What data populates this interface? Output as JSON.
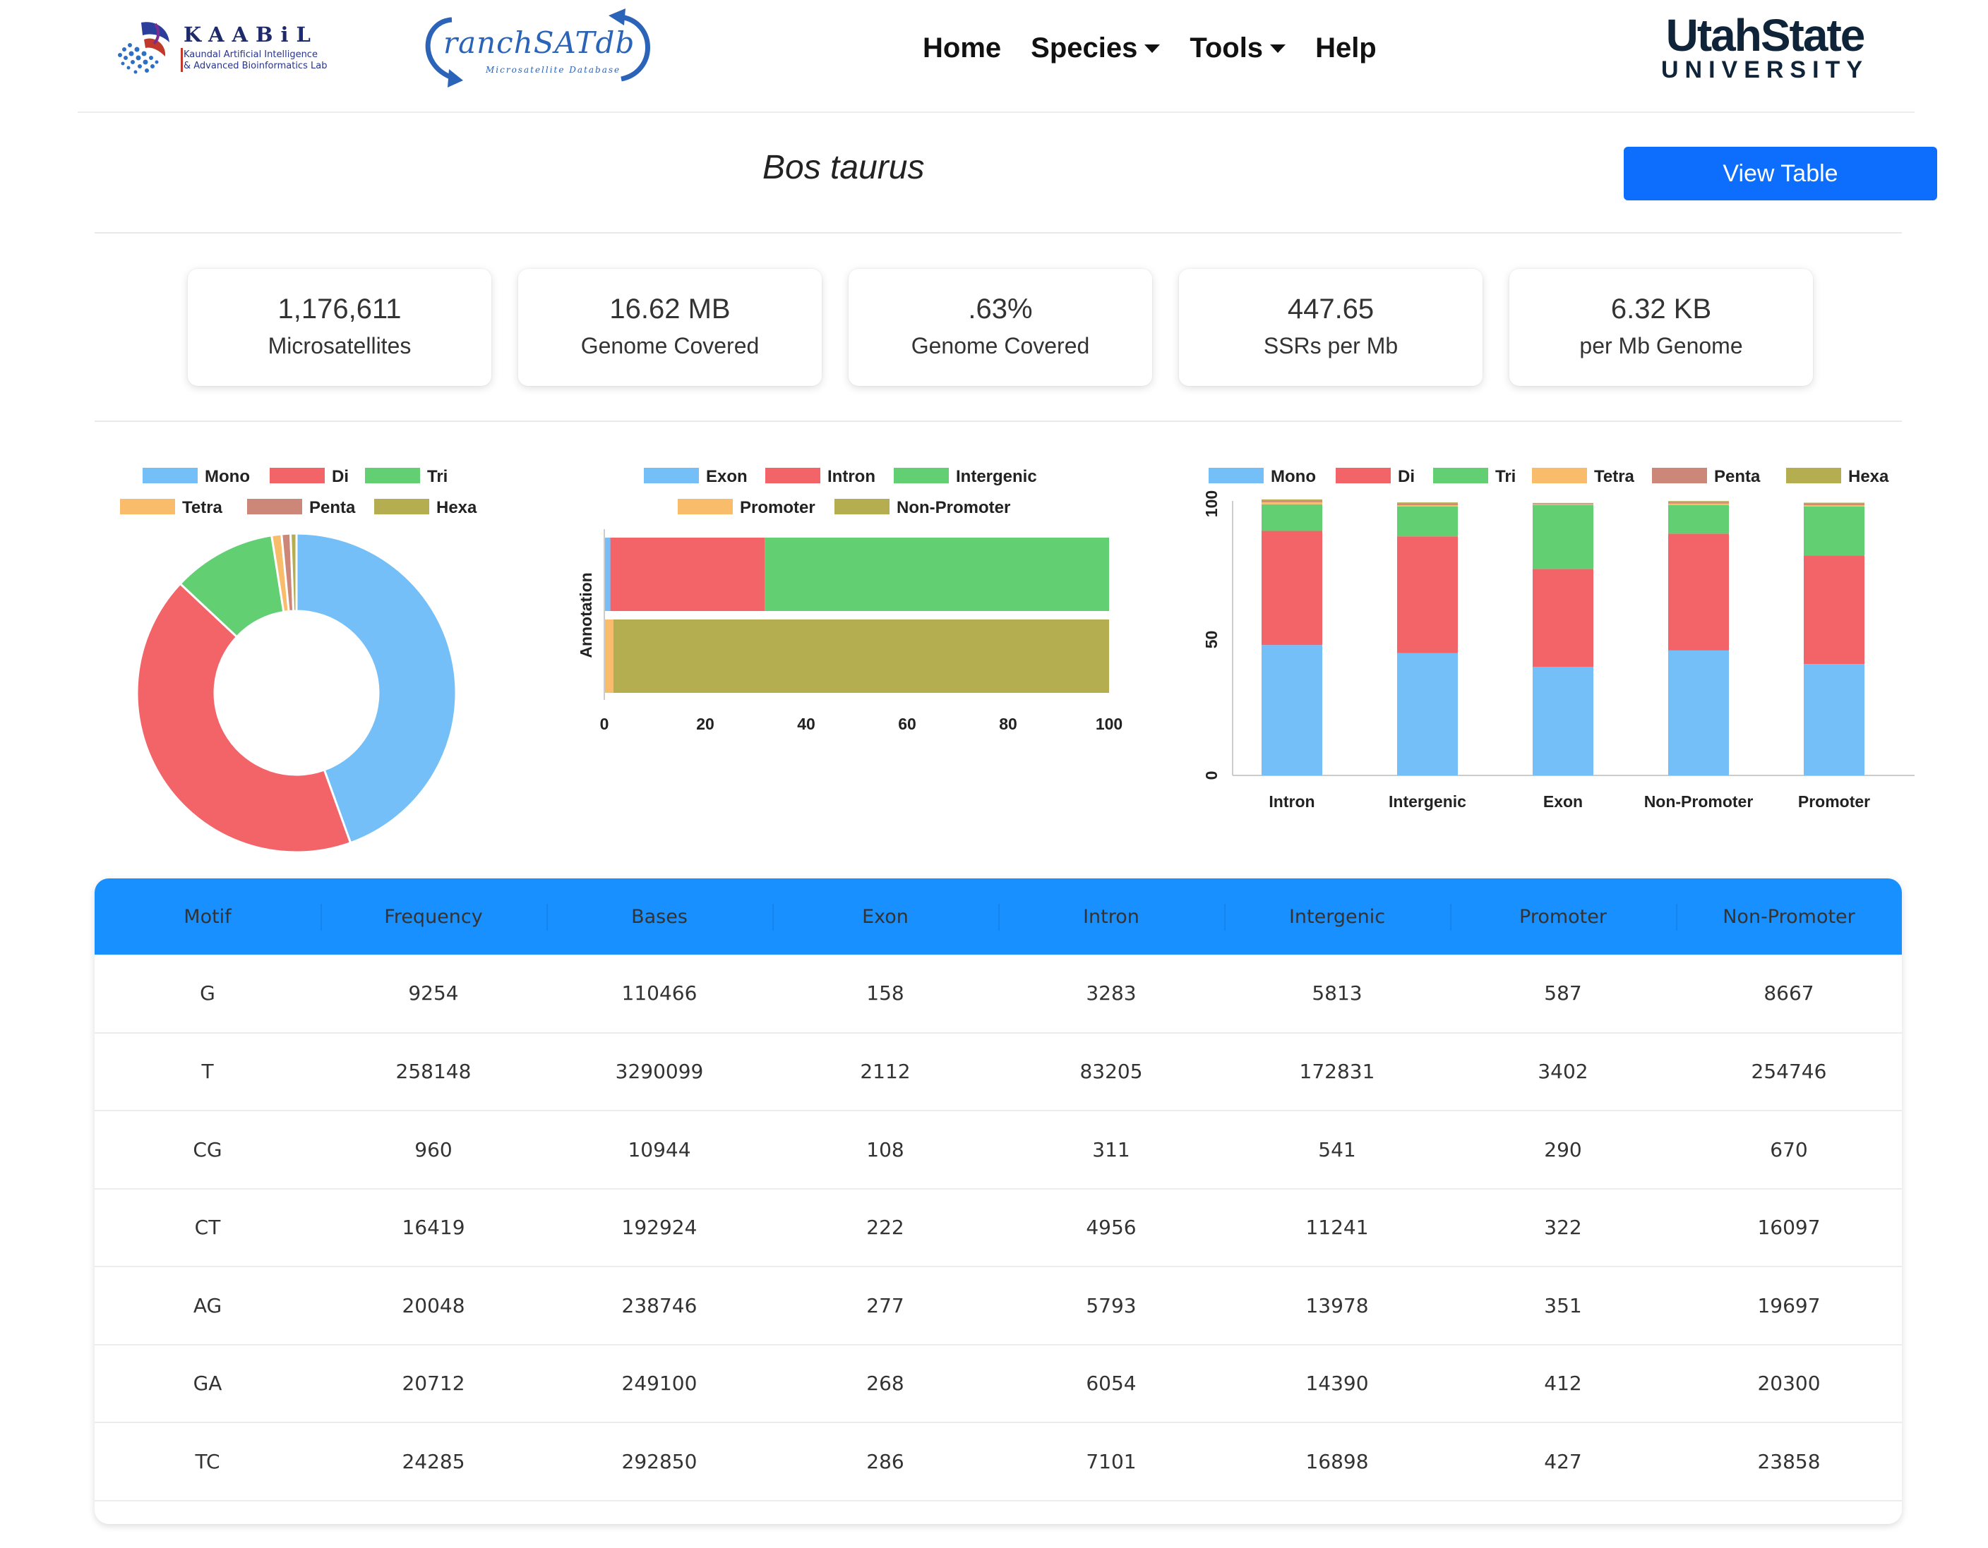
{
  "navbar": {
    "kaabil_logo": {
      "title": "KAABiL",
      "line1": "Kaundal Artificial Intelligence",
      "line2": "& Advanced Bioinformatics Lab"
    },
    "ranch_logo": {
      "title": "ranchSATdb",
      "subtitle": "Microsatellite Database"
    },
    "links": [
      {
        "label": "Home"
      },
      {
        "label": "Species"
      },
      {
        "label": "Tools"
      },
      {
        "label": "Help"
      }
    ],
    "usu_logo": {
      "line1": "UtahState",
      "line2": "UNIVERSITY"
    }
  },
  "header": {
    "species": "Bos taurus",
    "view_table_label": "View Table"
  },
  "stats": [
    {
      "value": "1,176,611",
      "label": "Microsatellites"
    },
    {
      "value": "16.62 MB",
      "label": "Genome Covered"
    },
    {
      "value": ".63%",
      "label": "Genome Covered"
    },
    {
      "value": "447.65",
      "label": "SSRs per Mb"
    },
    {
      "value": "6.32 KB",
      "label": "per Mb Genome"
    }
  ],
  "colors": {
    "mono": "#74bff8",
    "di": "#f26468",
    "tri": "#63cf73",
    "tetra": "#f9bc6b",
    "penta": "#cd8778",
    "hexa": "#b4ae50",
    "exon": "#74bff8",
    "intron": "#f26468",
    "intergenic": "#63cf73",
    "promoter": "#f9bc6b",
    "non_promoter": "#b4ae50",
    "accent": "#0d6efd",
    "table_header": "#1890ff"
  },
  "chart_data": [
    {
      "type": "pie",
      "donut": true,
      "legend": [
        "Mono",
        "Di",
        "Tri",
        "Tetra",
        "Penta",
        "Hexa"
      ],
      "values": [
        44.5,
        42.5,
        10.5,
        1.0,
        0.9,
        0.6
      ],
      "legend_position": "top"
    },
    {
      "type": "bar",
      "orientation": "horizontal",
      "stacked": true,
      "ylabel": "Annotation",
      "legend": [
        "Exon",
        "Intron",
        "Intergenic",
        "Promoter",
        "Non-Promoter"
      ],
      "xlim": [
        0,
        100
      ],
      "x_ticks": [
        "0",
        "20",
        "40",
        "60",
        "80",
        "100"
      ],
      "bars": [
        {
          "segments": [
            {
              "name": "Exon",
              "value": 1.2
            },
            {
              "name": "Intron",
              "value": 30.6
            },
            {
              "name": "Intergenic",
              "value": 68.2
            }
          ]
        },
        {
          "segments": [
            {
              "name": "Promoter",
              "value": 1.8
            },
            {
              "name": "Non-Promoter",
              "value": 98.2
            }
          ]
        }
      ]
    },
    {
      "type": "bar",
      "stacked": true,
      "categories": [
        "Intron",
        "Intergenic",
        "Exon",
        "Non-Promoter",
        "Promoter"
      ],
      "ylim": [
        0,
        100
      ],
      "y_ticks": [
        "0",
        "50",
        "100"
      ],
      "series": [
        {
          "name": "Mono",
          "values": [
            48,
            45,
            40,
            46,
            41
          ]
        },
        {
          "name": "Di",
          "values": [
            42,
            43,
            36,
            43,
            40
          ]
        },
        {
          "name": "Tri",
          "values": [
            9.8,
            11.0,
            23.5,
            10.5,
            18.0
          ]
        },
        {
          "name": "Tetra",
          "values": [
            0.8,
            0.5,
            0.3,
            0.6,
            0.5
          ]
        },
        {
          "name": "Penta",
          "values": [
            0.6,
            0.6,
            0.3,
            0.5,
            0.5
          ]
        },
        {
          "name": "Hexa",
          "values": [
            0.4,
            0.4,
            0.2,
            0.4,
            0.4
          ]
        }
      ],
      "legend_position": "top"
    }
  ],
  "table": {
    "columns": [
      "Motif",
      "Frequency",
      "Bases",
      "Exon",
      "Intron",
      "Intergenic",
      "Promoter",
      "Non-Promoter"
    ],
    "rows": [
      [
        "G",
        "9254",
        "110466",
        "158",
        "3283",
        "5813",
        "587",
        "8667"
      ],
      [
        "T",
        "258148",
        "3290099",
        "2112",
        "83205",
        "172831",
        "3402",
        "254746"
      ],
      [
        "CG",
        "960",
        "10944",
        "108",
        "311",
        "541",
        "290",
        "670"
      ],
      [
        "CT",
        "16419",
        "192924",
        "222",
        "4956",
        "11241",
        "322",
        "16097"
      ],
      [
        "AG",
        "20048",
        "238746",
        "277",
        "5793",
        "13978",
        "351",
        "19697"
      ],
      [
        "GA",
        "20712",
        "249100",
        "268",
        "6054",
        "14390",
        "412",
        "20300"
      ],
      [
        "TC",
        "24285",
        "292850",
        "286",
        "7101",
        "16898",
        "427",
        "23858"
      ]
    ]
  }
}
